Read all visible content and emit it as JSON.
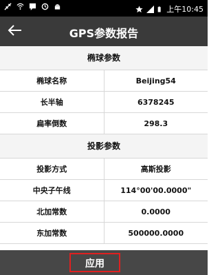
{
  "status_bar": {
    "time": "上午10:45",
    "icons": [
      "usb-icon",
      "wifi-icon",
      "message-icon",
      "sync-icon",
      "android-icon",
      "star-icon",
      "signal-icon",
      "battery-icon"
    ]
  },
  "header": {
    "title": "GPS参数报告",
    "back_icon": "arrow-left-icon"
  },
  "ellipsoid": {
    "heading": "椭球参数",
    "rows": [
      {
        "label": "椭球名称",
        "value": "Beijing54"
      },
      {
        "label": "长半轴",
        "value": "6378245"
      },
      {
        "label": "扁率倒数",
        "value": "298.3"
      }
    ]
  },
  "projection": {
    "heading": "投影参数",
    "rows": [
      {
        "label": "投影方式",
        "value": "高斯投影"
      },
      {
        "label": "中央子午线",
        "value": "114°00'00.0000\""
      },
      {
        "label": "北加常数",
        "value": "0.0000"
      },
      {
        "label": "东加常数",
        "value": "500000.0000"
      }
    ]
  },
  "footer": {
    "apply_label": "应用"
  },
  "colors": {
    "appbar": "#3a3a3a",
    "bottombar": "#474747",
    "highlight": "#e02020"
  }
}
